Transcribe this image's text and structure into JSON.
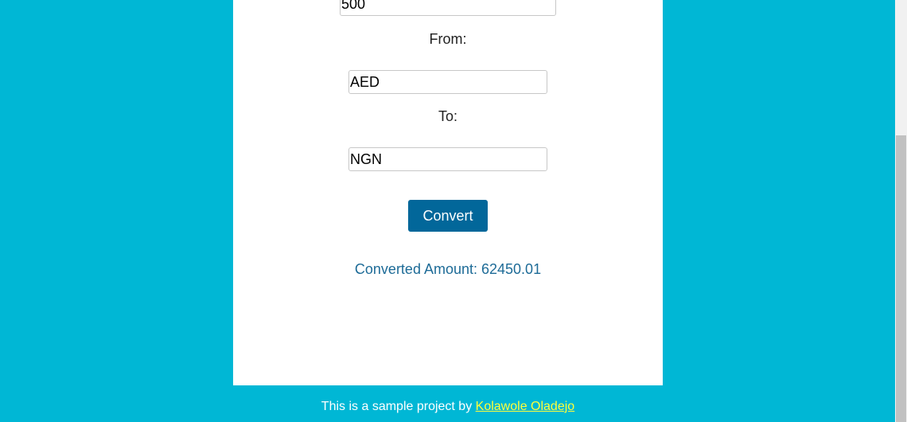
{
  "form": {
    "amount_value": "500",
    "from_label": "From:",
    "from_value": "AED",
    "to_label": "To:",
    "to_value": "NGN",
    "convert_label": "Convert",
    "result_text": "Converted Amount: 62450.01"
  },
  "footer": {
    "text": "This is a sample project by ",
    "author_link": "Kolawole Oladejo"
  },
  "colors": {
    "background": "#00b7d5",
    "button": "#02679a",
    "result_text": "#1d6b97",
    "footer_link": "#ffff3a"
  }
}
